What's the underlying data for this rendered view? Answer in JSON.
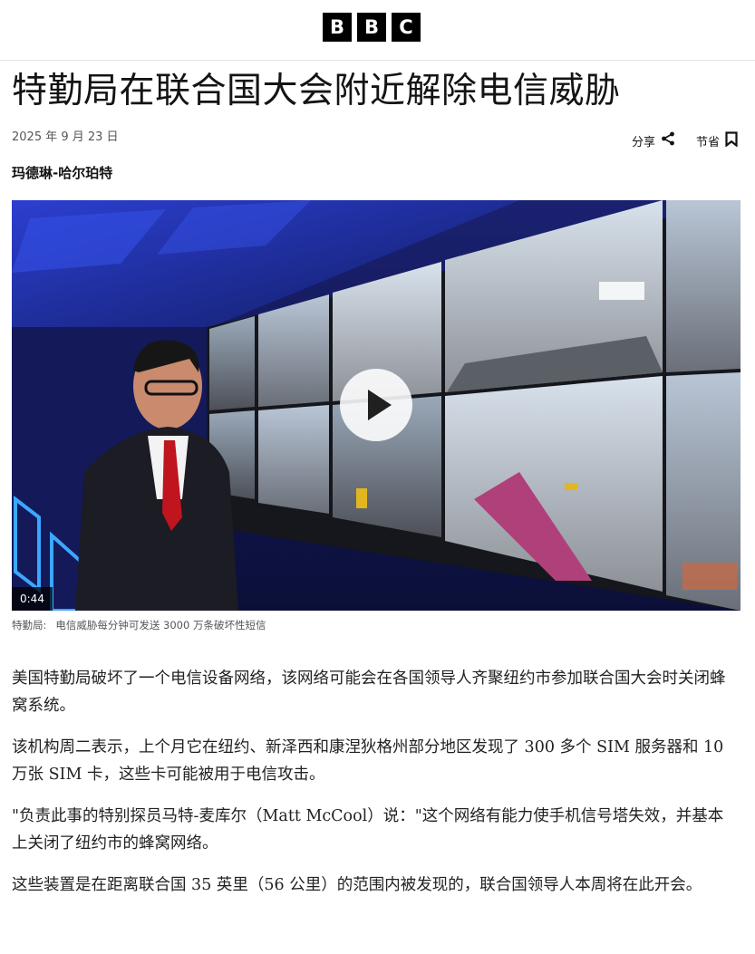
{
  "header": {
    "logo_letters": [
      "B",
      "B",
      "C"
    ]
  },
  "article": {
    "headline": "特勤局在联合国大会附近解除电信威胁",
    "date": "2025 年 9 月 23 日",
    "share_label": "分享",
    "save_label": "节省",
    "byline": "玛德琳-哈尔珀特",
    "video": {
      "duration": "0:44",
      "caption_label": "特勤局:",
      "caption_text": "电信威胁每分钟可发送 3000 万条破坏性短信"
    },
    "paragraphs": [
      "美国特勤局破坏了一个电信设备网络，该网络可能会在各国领导人齐聚纽约市参加联合国大会时关闭蜂窝系统。",
      "该机构周二表示，上个月它在纽约、新泽西和康涅狄格州部分地区发现了 300 多个 SIM 服务器和 10 万张 SIM 卡，这些卡可能被用于电信攻击。",
      "\"负责此事的特别探员马特-麦库尔（Matt McCool）说：\"这个网络有能力使手机信号塔失效，并基本上关闭了纽约市的蜂窝网络。",
      "这些装置是在距离联合国 35 英里（56 公里）的范围内被发现的，联合国领导人本周将在此开会。"
    ]
  },
  "colors": {
    "text": "#141414",
    "meta": "#545658",
    "body_text": "#202224",
    "logo_bg": "#000000"
  },
  "icons": {
    "share": "share-icon",
    "save": "bookmark-icon",
    "play": "play-icon"
  }
}
